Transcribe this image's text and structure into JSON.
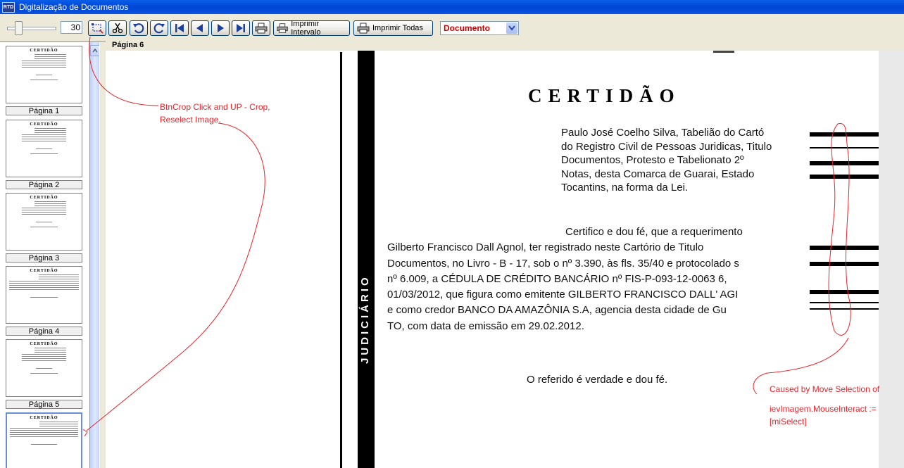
{
  "window": {
    "title": "Digitalização de Documentos",
    "app_icon_text": "RTD"
  },
  "toolbar": {
    "zoom_value": "30",
    "print_interval_label": "Imprimir Intervalo",
    "print_all_label": "Imprimir Todas",
    "doc_type_selected": "Documento"
  },
  "thumbnails": {
    "items": [
      {
        "label": "Página 1"
      },
      {
        "label": "Página 2"
      },
      {
        "label": "Página 3"
      },
      {
        "label": "Página 4"
      },
      {
        "label": "Página 5"
      }
    ],
    "mini_title": "CERTIDÃO"
  },
  "viewer": {
    "page_label": "Página 6",
    "side_text": "JUDICIÁRIO",
    "doc_title": "CERTIDÃO",
    "header_lines": [
      "Paulo José Coelho Silva, Tabelião do Cartó",
      "do Registro Civil de Pessoas Juridicas, Titulo",
      "Documentos, Protesto e Tabelionato 2º",
      "Notas, desta Comarca de Guarai, Estado",
      "Tocantins, na forma da Lei."
    ],
    "body_lines": [
      "Certifico e dou fé, que a requerimento",
      "Gilberto Francisco Dall Agnol, ter registrado neste Cartório de Titulo",
      "Documentos, no Livro - B - 17, sob o nº 3.390, às fls. 35/40 e protocolado s",
      "nº 6.009, a CÉDULA DE CRÉDITO BANCÁRIO nº FIS-P-093-12-0063 6,",
      "01/03/2012, que figura como emitente GILBERTO FRANCISCO DALL' AGI",
      "e como credor BANCO DA AMAZÔNIA S.A, agencia desta cidade de Gu",
      "TO, com data de emissão em 29.02.2012."
    ],
    "closing": "O referido é verdade e dou fé."
  },
  "annotations": {
    "crop_note_line1": "BtnCrop Click and UP - Crop,",
    "crop_note_line2": "Reselect Image.",
    "move_note_line1": "Caused by Move Selection of",
    "move_note_line2": "ievImagem.MouseInteract :=",
    "move_note_line3": "[miSelect]",
    "color": "#e8242b"
  }
}
